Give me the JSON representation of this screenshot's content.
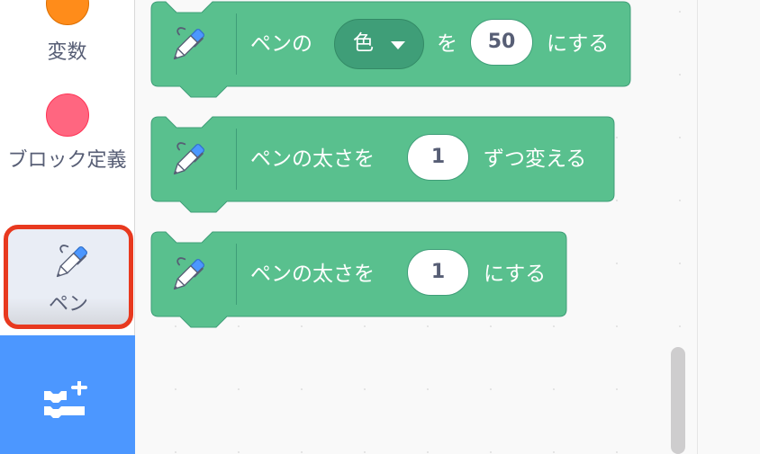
{
  "sidebar": {
    "categories": [
      {
        "label": "変数",
        "color": "#ff8c1a"
      },
      {
        "label": "ブロック定義",
        "color": "#ff6680"
      },
      {
        "label": "ペン",
        "icon": "pen-icon",
        "selected": true
      }
    ],
    "extension_icon": "add-extension-icon",
    "extension_color": "#4c97ff"
  },
  "blocks": [
    {
      "id": "set-pen-color-param",
      "icon": "pen-icon",
      "text_1": "ペンの",
      "dropdown_value": "色",
      "text_2": "を",
      "input_value": "50",
      "text_3": "にする"
    },
    {
      "id": "change-pen-size",
      "icon": "pen-icon",
      "text_1": "ペンの太さを",
      "input_value": "1",
      "text_2": "ずつ変える"
    },
    {
      "id": "set-pen-size",
      "icon": "pen-icon",
      "text_1": "ペンの太さを",
      "input_value": "1",
      "text_2": "にする"
    }
  ],
  "colors": {
    "pen_block": "#59c08e",
    "pen_block_border": "#3f9e78",
    "selection_highlight": "#e8391f"
  }
}
